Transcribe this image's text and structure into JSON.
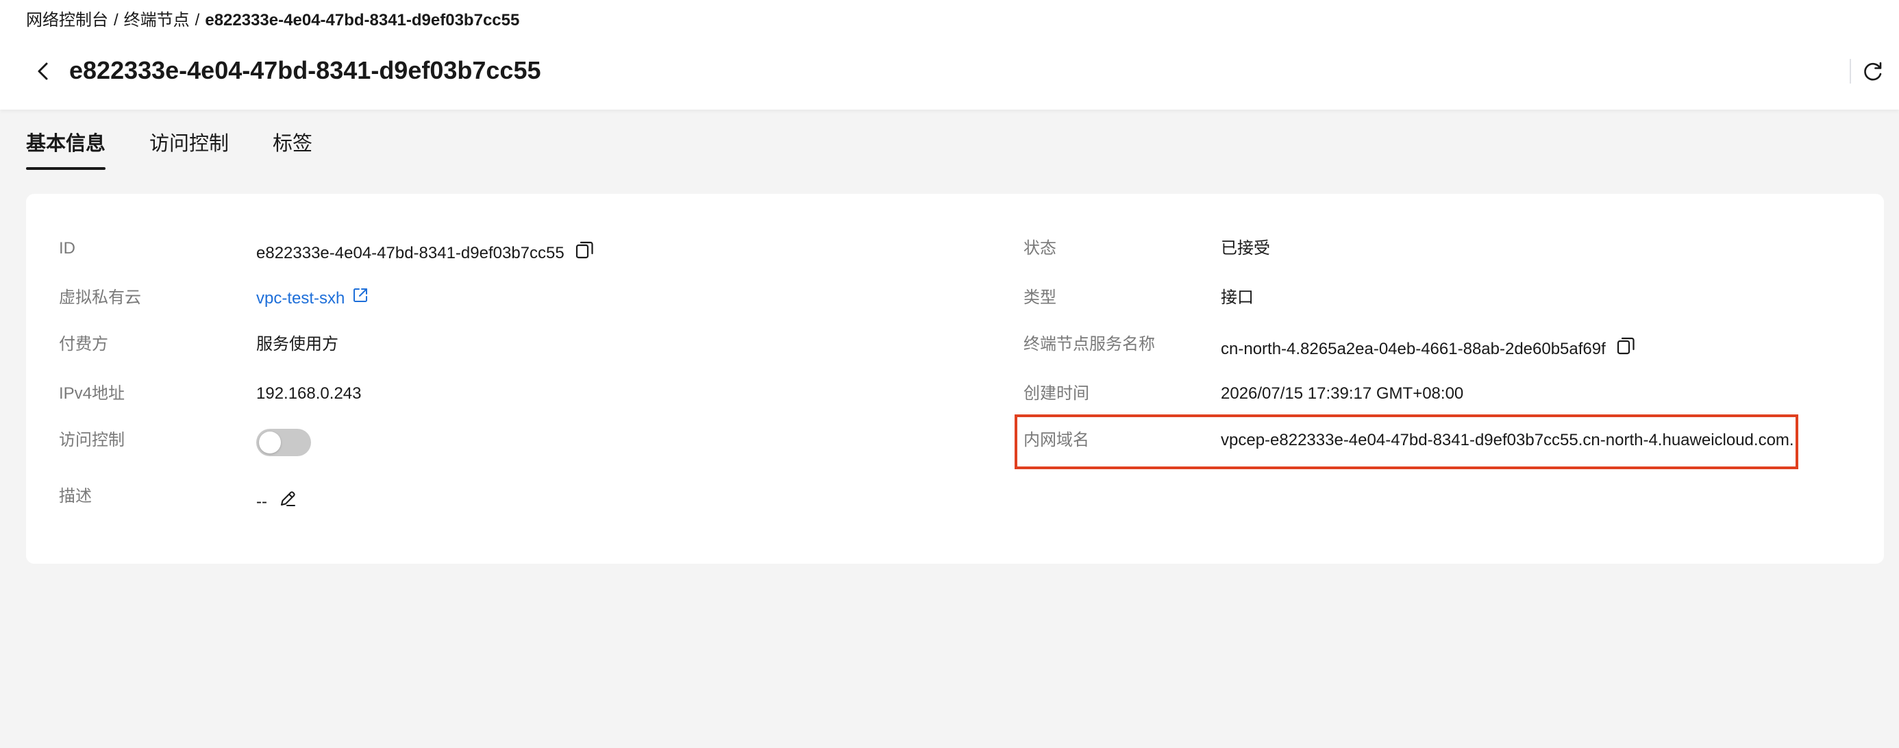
{
  "breadcrumb": {
    "items": [
      "网络控制台",
      "终端节点"
    ],
    "separator": "/",
    "current": "e822333e-4e04-47bd-8341-d9ef03b7cc55"
  },
  "header": {
    "title": "e822333e-4e04-47bd-8341-d9ef03b7cc55",
    "back_icon": "chevron-left-icon",
    "refresh_icon": "refresh-icon"
  },
  "tabs": [
    {
      "label": "基本信息",
      "active": true
    },
    {
      "label": "访问控制",
      "active": false
    },
    {
      "label": "标签",
      "active": false
    }
  ],
  "info": {
    "left": {
      "id": {
        "label": "ID",
        "value": "e822333e-4e04-47bd-8341-d9ef03b7cc55"
      },
      "vpc": {
        "label": "虚拟私有云",
        "value": "vpc-test-sxh"
      },
      "payer": {
        "label": "付费方",
        "value": "服务使用方"
      },
      "ipv4": {
        "label": "IPv4地址",
        "value": "192.168.0.243"
      },
      "access_control": {
        "label": "访问控制",
        "enabled": false
      },
      "description": {
        "label": "描述",
        "value": "--"
      }
    },
    "right": {
      "status": {
        "label": "状态",
        "value": "已接受"
      },
      "type": {
        "label": "类型",
        "value": "接口"
      },
      "service_name": {
        "label": "终端节点服务名称",
        "value": "cn-north-4.8265a2ea-04eb-4661-88ab-2de60b5af69f"
      },
      "created": {
        "label": "创建时间",
        "value": "2026/07/15 17:39:17 GMT+08:00"
      },
      "domain": {
        "label": "内网域名",
        "value": "vpcep-e822333e-4e04-47bd-8341-d9ef03b7cc55.cn-north-4.huaweicloud.com."
      }
    }
  },
  "colors": {
    "link": "#1e6fd9",
    "highlight": "#e0401f",
    "label": "#7a7a7a",
    "text": "#191919",
    "background": "#f4f4f4"
  }
}
